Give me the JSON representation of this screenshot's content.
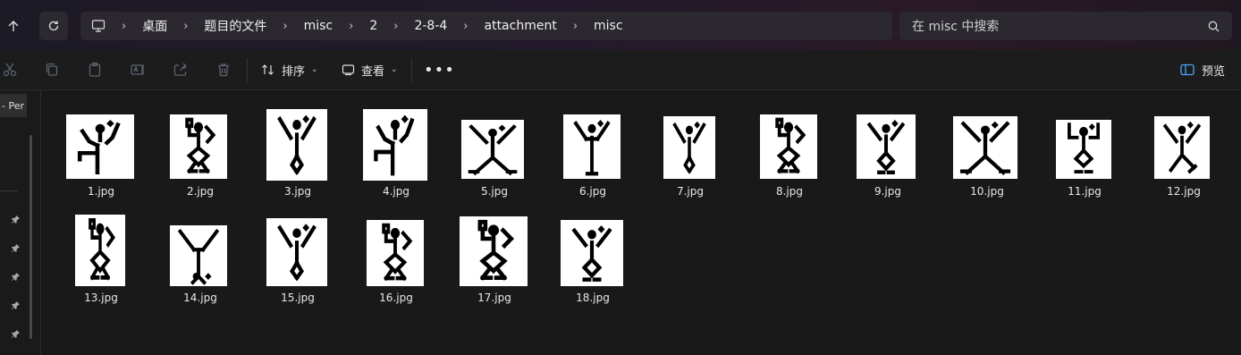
{
  "breadcrumb": [
    "桌面",
    "题目的文件",
    "misc",
    "2",
    "2-8-4",
    "attachment",
    "misc"
  ],
  "search": {
    "placeholder": "在 misc 中搜索"
  },
  "toolbar": {
    "sort_label": "排序",
    "view_label": "查看",
    "more_label": "•••",
    "preview_label": "预览"
  },
  "leftpane": {
    "item_label": "- Per"
  },
  "files": [
    {
      "name": "1.jpg",
      "pose": "leg-left"
    },
    {
      "name": "2.jpg",
      "pose": "arm-up-knees"
    },
    {
      "name": "3.jpg",
      "pose": "y-wavy"
    },
    {
      "name": "4.jpg",
      "pose": "leg-left"
    },
    {
      "name": "5.jpg",
      "pose": "x-spread"
    },
    {
      "name": "6.jpg",
      "pose": "y-straight"
    },
    {
      "name": "7.jpg",
      "pose": "y-wavy"
    },
    {
      "name": "8.jpg",
      "pose": "arm-up-knees"
    },
    {
      "name": "9.jpg",
      "pose": "y-knees"
    },
    {
      "name": "10.jpg",
      "pose": "x-spread"
    },
    {
      "name": "11.jpg",
      "pose": "both-up-knees"
    },
    {
      "name": "12.jpg",
      "pose": "y-spread"
    },
    {
      "name": "13.jpg",
      "pose": "arm-up-knees"
    },
    {
      "name": "14.jpg",
      "pose": "upside-y"
    },
    {
      "name": "15.jpg",
      "pose": "y-wavy"
    },
    {
      "name": "16.jpg",
      "pose": "arm-up-knees"
    },
    {
      "name": "17.jpg",
      "pose": "arm-up-knees"
    },
    {
      "name": "18.jpg",
      "pose": "y-knees"
    }
  ],
  "colors": {
    "accent": "#4aa3ff",
    "figure": "#000000",
    "thumb_bg": "#ffffff"
  }
}
